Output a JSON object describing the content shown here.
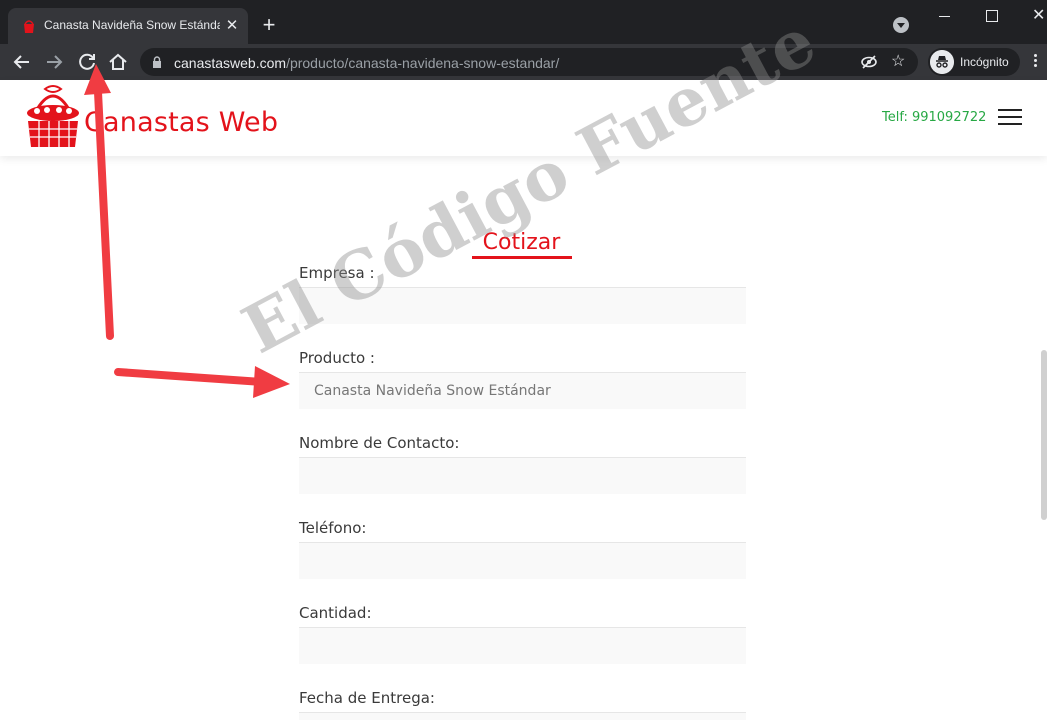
{
  "browser": {
    "tab_title": "Canasta Navideña Snow Estándar",
    "url_host": "canastasweb.com",
    "url_path": "/producto/canasta-navidena-snow-estandar/",
    "incognito_label": "Incógnito",
    "icons": [
      "favicon-icon",
      "close-icon",
      "new-tab-icon",
      "tab-search-icon",
      "minimize-icon",
      "maximize-icon",
      "close-window-icon",
      "back-icon",
      "forward-icon",
      "reload-icon",
      "home-icon",
      "lock-icon",
      "eye-off-icon",
      "star-icon",
      "incognito-icon",
      "menu-icon"
    ]
  },
  "site": {
    "brand": "Canastas Web",
    "phone": "Telf: 991092722",
    "brand_color": "#e3131b",
    "phone_color": "#27a844"
  },
  "form": {
    "title": "Cotizar",
    "fields": [
      {
        "label": "Empresa :",
        "value": ""
      },
      {
        "label": "Producto :",
        "value": "Canasta Navideña Snow Estándar"
      },
      {
        "label": "Nombre de Contacto:",
        "value": ""
      },
      {
        "label": "Teléfono:",
        "value": ""
      },
      {
        "label": "Cantidad:",
        "value": ""
      },
      {
        "label": "Fecha de Entrega:",
        "value": ""
      }
    ]
  },
  "watermark": "El Código Fuente",
  "annotations": {
    "arrow_color": "#f03c42"
  }
}
